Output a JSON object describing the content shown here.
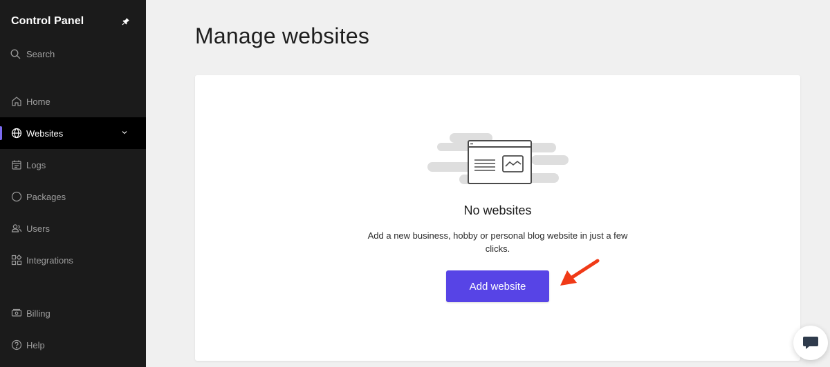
{
  "sidebar": {
    "title": "Control Panel",
    "search_label": "Search",
    "items": [
      {
        "label": "Home",
        "icon": "home-icon"
      },
      {
        "label": "Websites",
        "icon": "globe-icon",
        "active": true
      },
      {
        "label": "Logs",
        "icon": "calendar-icon"
      },
      {
        "label": "Packages",
        "icon": "circle-icon"
      },
      {
        "label": "Users",
        "icon": "users-icon"
      },
      {
        "label": "Integrations",
        "icon": "grid-icon"
      }
    ],
    "bottom_items": [
      {
        "label": "Billing",
        "icon": "billing-icon"
      },
      {
        "label": "Help",
        "icon": "help-icon"
      }
    ]
  },
  "main": {
    "title": "Manage websites",
    "empty_state": {
      "title": "No websites",
      "description": "Add a new business, hobby or personal blog website in just a few clicks.",
      "button_label": "Add website"
    }
  },
  "colors": {
    "accent": "#5744e6",
    "sidebar_bg": "#1b1b1b",
    "annotation_arrow": "#f03a17"
  }
}
